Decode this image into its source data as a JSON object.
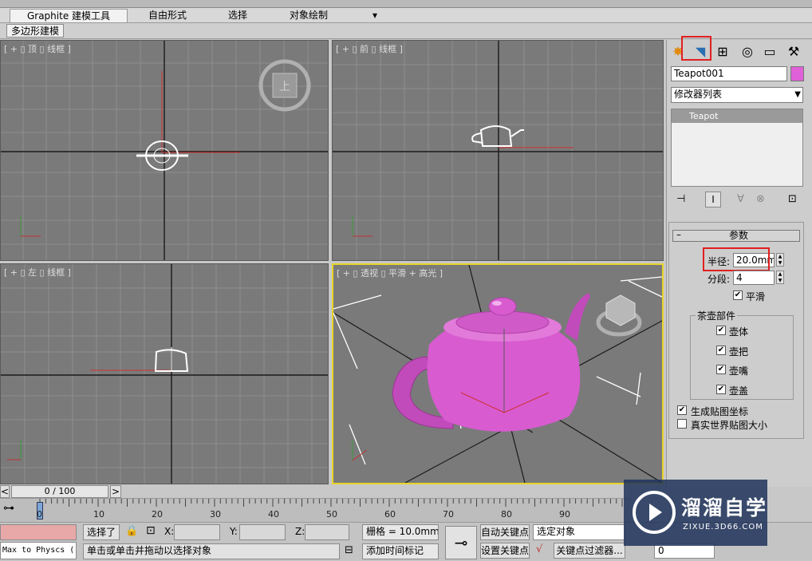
{
  "ribbon": {
    "tabs": [
      {
        "label": "Graphite 建模工具",
        "active": true
      },
      {
        "label": "自由形式",
        "active": false
      },
      {
        "label": "选择",
        "active": false
      },
      {
        "label": "对象绘制",
        "active": false
      }
    ],
    "dropdown_glyph": "▾",
    "subtab": "多边形建模"
  },
  "viewports": {
    "top": {
      "label": "[ + ▯ 顶 ▯ 线框 ]"
    },
    "front": {
      "label": "[ + ▯ 前 ▯ 线框 ]"
    },
    "left": {
      "label": "[ + ▯ 左 ▯ 线框 ]"
    },
    "persp": {
      "label": "[ + ▯ 透视 ▯ 平滑 + 高光 ]"
    },
    "viewcube_face": "上",
    "colors": {
      "bg": "#7a7a7a",
      "grid": "#8c8c8c",
      "axis": "#1a1a1a",
      "teapot": "#d85bd0",
      "active_border": "#e7d42a"
    }
  },
  "command_panel": {
    "tab_icons": [
      "create-icon",
      "modify-icon",
      "hierarchy-icon",
      "motion-icon",
      "display-icon",
      "utilities-icon"
    ],
    "object_name": "Teapot001",
    "object_color": "#e060d8",
    "modifier_list": "修改器列表",
    "stack_item": "Teapot",
    "rollout_title": "参数",
    "radius_label": "半径:",
    "radius_value": "20.0mm",
    "segments_label": "分段:",
    "segments_value": "4",
    "smooth_label": "平滑",
    "parts_group": "茶壶部件",
    "parts": [
      "壶体",
      "壶把",
      "壶嘴",
      "壶盖"
    ],
    "gen_mapping": "生成贴图坐标",
    "real_world": "真实世界贴图大小",
    "accent": "#e02020"
  },
  "timeline": {
    "frame_display": "0 / 100",
    "prev": "<",
    "next": ">",
    "ticks": [
      "0",
      "10",
      "20",
      "30",
      "40",
      "50",
      "60",
      "70",
      "80",
      "90"
    ]
  },
  "status": {
    "script_listener": "Max to Physcs (",
    "selection": "选择了",
    "x_label": "X:",
    "y_label": "Y:",
    "z_label": "Z:",
    "grid": "栅格 = 10.0mm",
    "prompt": "单击或单击并拖动以选择对象",
    "add_tag": "添加时间标记",
    "auto_key": "自动关键点",
    "set_key": "设置关键点",
    "selected_object": "选定对象",
    "key_filters": "关键点过滤器...",
    "frame_value": "0"
  },
  "watermark": {
    "brand": "溜溜自学",
    "url": "ZIXUE.3D66.COM"
  }
}
